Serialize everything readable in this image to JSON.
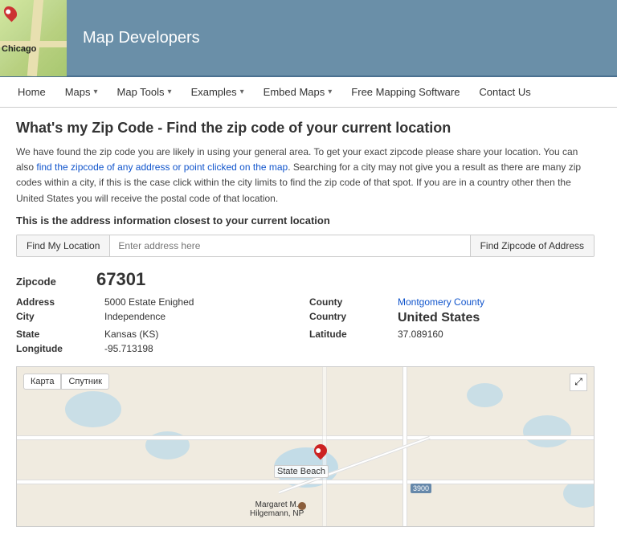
{
  "header": {
    "brand": "Map Developers",
    "chicago_label": "Chicago",
    "nav": [
      {
        "label": "Home",
        "has_dropdown": false
      },
      {
        "label": "Maps",
        "has_dropdown": true
      },
      {
        "label": "Map Tools",
        "has_dropdown": true
      },
      {
        "label": "Examples",
        "has_dropdown": true
      },
      {
        "label": "Embed Maps",
        "has_dropdown": true
      },
      {
        "label": "Free Mapping Software",
        "has_dropdown": false
      },
      {
        "label": "Contact Us",
        "has_dropdown": false
      }
    ]
  },
  "page": {
    "title": "What's my Zip Code - Find the zip code of your current location",
    "description1": "We have found the zip code you are likely in using your general area. To get your exact zipcode please share your location. You can also find the zipcode of any address or point clicked on the map. Searching for a city may not give you a result as there are many zip codes within a city, if this is the case click within the city limits to find the zip code of that spot. If you are in a country other then the United States you will receive the postal code of that location.",
    "section_subtitle": "This is the address information closest to your current location"
  },
  "search": {
    "find_my_location": "Find My Location",
    "placeholder": "Enter address here",
    "find_zip_btn": "Find Zipcode of Address"
  },
  "location": {
    "zipcode_label": "Zipcode",
    "zipcode_value": "67301",
    "fields": [
      {
        "label": "Address",
        "value": "5000 Estate Enighed"
      },
      {
        "label": "City",
        "value": "Independence"
      },
      {
        "label": "State",
        "value": "Kansas (KS)"
      },
      {
        "label": "Longitude",
        "value": "-95.713198"
      },
      {
        "label": "County",
        "value": "Montgomery County"
      },
      {
        "label": "Country",
        "value": "United States"
      },
      {
        "label": "Latitude",
        "value": "37.089160"
      }
    ]
  },
  "map": {
    "controls": [
      "Карта",
      "Спутник"
    ],
    "pin_label": "State Beach",
    "person_label": "Margaret M. Hilgemann, NP",
    "road_number": "3900",
    "fullscreen_icon": "⤢"
  }
}
